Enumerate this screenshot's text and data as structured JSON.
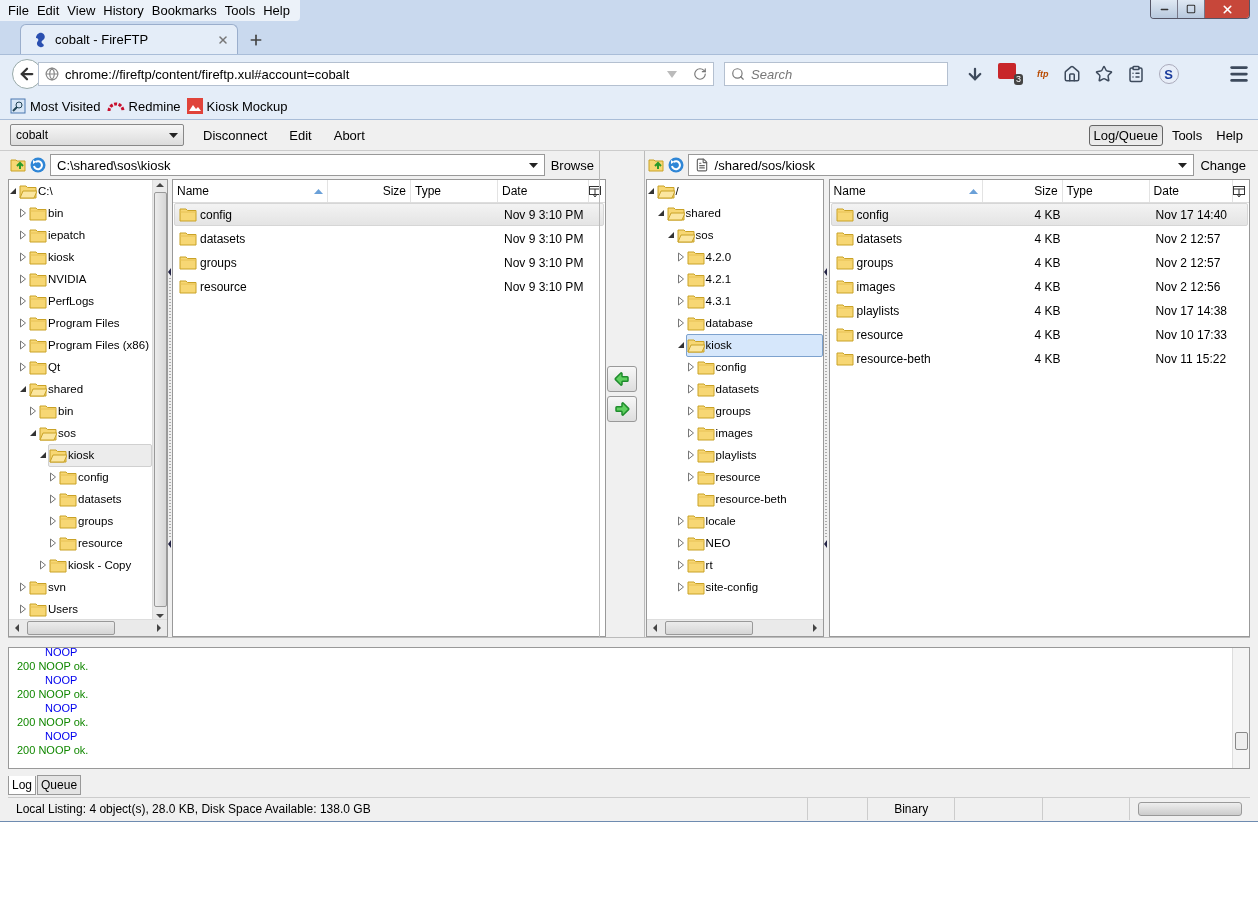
{
  "menu": [
    "File",
    "Edit",
    "View",
    "History",
    "Bookmarks",
    "Tools",
    "Help"
  ],
  "tab": {
    "title": "cobalt - FireFTP",
    "selected": true
  },
  "address": {
    "value": "chrome://fireftp/content/fireftp.xul#account=cobalt"
  },
  "search": {
    "placeholder": "Search"
  },
  "nav_toolbar": {
    "extension_badge": "3",
    "ftp_logo": "ftp",
    "s_logo": "S"
  },
  "bookmarks": [
    {
      "label": "Most Visited",
      "kind": "folder"
    },
    {
      "label": "Redmine",
      "kind": "redmine"
    },
    {
      "label": "Kiosk Mockup",
      "kind": "image"
    }
  ],
  "fireftp_toolbar": {
    "account": "cobalt",
    "left_buttons": [
      "Disconnect",
      "Edit",
      "Abort"
    ],
    "right_buttons": [
      {
        "label": "Log/Queue",
        "pressed": true
      },
      {
        "label": "Tools",
        "pressed": false
      },
      {
        "label": "Help",
        "pressed": false
      }
    ]
  },
  "local": {
    "path": "C:\\shared\\sos\\kiosk",
    "path_button": "Browse",
    "tree": [
      {
        "label": "C:\\",
        "expandable": true,
        "expanded": true,
        "selected": false,
        "children": [
          {
            "label": "bin",
            "expandable": true,
            "expanded": false,
            "selected": false
          },
          {
            "label": "iepatch",
            "expandable": true,
            "expanded": false,
            "selected": false
          },
          {
            "label": "kiosk",
            "expandable": true,
            "expanded": false,
            "selected": false
          },
          {
            "label": "NVIDIA",
            "expandable": true,
            "expanded": false,
            "selected": false
          },
          {
            "label": "PerfLogs",
            "expandable": true,
            "expanded": false,
            "selected": false
          },
          {
            "label": "Program Files",
            "expandable": true,
            "expanded": false,
            "selected": false
          },
          {
            "label": "Program Files (x86)",
            "expandable": true,
            "expanded": false,
            "selected": false
          },
          {
            "label": "Qt",
            "expandable": true,
            "expanded": false,
            "selected": false
          },
          {
            "label": "shared",
            "expandable": true,
            "expanded": true,
            "selected": false,
            "children": [
              {
                "label": "bin",
                "expandable": true,
                "expanded": false,
                "selected": false
              },
              {
                "label": "sos",
                "expandable": true,
                "expanded": true,
                "selected": false,
                "children": [
                  {
                    "label": "kiosk",
                    "expandable": true,
                    "expanded": true,
                    "selected": true,
                    "children": [
                      {
                        "label": "config",
                        "expandable": true,
                        "expanded": false,
                        "selected": false
                      },
                      {
                        "label": "datasets",
                        "expandable": true,
                        "expanded": false,
                        "selected": false
                      },
                      {
                        "label": "groups",
                        "expandable": true,
                        "expanded": false,
                        "selected": false
                      },
                      {
                        "label": "resource",
                        "expandable": true,
                        "expanded": false,
                        "selected": false
                      }
                    ]
                  },
                  {
                    "label": "kiosk - Copy",
                    "expandable": true,
                    "expanded": false,
                    "selected": false
                  }
                ]
              }
            ]
          },
          {
            "label": "svn",
            "expandable": true,
            "expanded": false,
            "selected": false
          },
          {
            "label": "Users",
            "expandable": true,
            "expanded": false,
            "selected": false
          }
        ]
      }
    ],
    "columns": [
      "Name",
      "Size",
      "Type",
      "Date"
    ],
    "rows": [
      {
        "name": "config",
        "size": "",
        "type": "",
        "date": "Nov 9 3:10 PM",
        "selected": true
      },
      {
        "name": "datasets",
        "size": "",
        "type": "",
        "date": "Nov 9 3:10 PM",
        "selected": false
      },
      {
        "name": "groups",
        "size": "",
        "type": "",
        "date": "Nov 9 3:10 PM",
        "selected": false
      },
      {
        "name": "resource",
        "size": "",
        "type": "",
        "date": "Nov 9 3:10 PM",
        "selected": false
      }
    ]
  },
  "remote": {
    "path": "/shared/sos/kiosk",
    "path_button": "Change",
    "tree": [
      {
        "label": "/",
        "expandable": true,
        "expanded": true,
        "selected": false,
        "children": [
          {
            "label": "shared",
            "expandable": true,
            "expanded": true,
            "selected": false,
            "children": [
              {
                "label": "sos",
                "expandable": true,
                "expanded": true,
                "selected": false,
                "children": [
                  {
                    "label": "4.2.0",
                    "expandable": true,
                    "expanded": false,
                    "selected": false
                  },
                  {
                    "label": "4.2.1",
                    "expandable": true,
                    "expanded": false,
                    "selected": false
                  },
                  {
                    "label": "4.3.1",
                    "expandable": true,
                    "expanded": false,
                    "selected": false
                  },
                  {
                    "label": "database",
                    "expandable": true,
                    "expanded": false,
                    "selected": false
                  },
                  {
                    "label": "kiosk",
                    "expandable": true,
                    "expanded": true,
                    "selected": true,
                    "children": [
                      {
                        "label": "config",
                        "expandable": true,
                        "expanded": false,
                        "selected": false
                      },
                      {
                        "label": "datasets",
                        "expandable": true,
                        "expanded": false,
                        "selected": false
                      },
                      {
                        "label": "groups",
                        "expandable": true,
                        "expanded": false,
                        "selected": false
                      },
                      {
                        "label": "images",
                        "expandable": true,
                        "expanded": false,
                        "selected": false
                      },
                      {
                        "label": "playlists",
                        "expandable": true,
                        "expanded": false,
                        "selected": false
                      },
                      {
                        "label": "resource",
                        "expandable": true,
                        "expanded": false,
                        "selected": false
                      },
                      {
                        "label": "resource-beth",
                        "expandable": false,
                        "expanded": false,
                        "selected": false
                      }
                    ]
                  },
                  {
                    "label": "locale",
                    "expandable": true,
                    "expanded": false,
                    "selected": false
                  },
                  {
                    "label": "NEO",
                    "expandable": true,
                    "expanded": false,
                    "selected": false
                  },
                  {
                    "label": "rt",
                    "expandable": true,
                    "expanded": false,
                    "selected": false
                  },
                  {
                    "label": "site-config",
                    "expandable": true,
                    "expanded": false,
                    "selected": false
                  }
                ]
              }
            ]
          }
        ]
      }
    ],
    "columns": [
      "Name",
      "Size",
      "Type",
      "Date"
    ],
    "rows": [
      {
        "name": "config",
        "size": "4 KB",
        "type": "",
        "date": "Nov 17 14:40",
        "selected": true
      },
      {
        "name": "datasets",
        "size": "4 KB",
        "type": "",
        "date": "Nov 2 12:57",
        "selected": false
      },
      {
        "name": "groups",
        "size": "4 KB",
        "type": "",
        "date": "Nov 2 12:57",
        "selected": false
      },
      {
        "name": "images",
        "size": "4 KB",
        "type": "",
        "date": "Nov 2 12:56",
        "selected": false
      },
      {
        "name": "playlists",
        "size": "4 KB",
        "type": "",
        "date": "Nov 17 14:38",
        "selected": false
      },
      {
        "name": "resource",
        "size": "4 KB",
        "type": "",
        "date": "Nov 10 17:33",
        "selected": false
      },
      {
        "name": "resource-beth",
        "size": "4 KB",
        "type": "",
        "date": "Nov 11 15:22",
        "selected": false
      }
    ]
  },
  "log": [
    {
      "text": "NOOP",
      "kind": "command"
    },
    {
      "text": "200 NOOP ok.",
      "kind": "response"
    },
    {
      "text": "NOOP",
      "kind": "command"
    },
    {
      "text": "200 NOOP ok.",
      "kind": "response"
    },
    {
      "text": "NOOP",
      "kind": "command"
    },
    {
      "text": "200 NOOP ok.",
      "kind": "response"
    },
    {
      "text": "NOOP",
      "kind": "command"
    },
    {
      "text": "200 NOOP ok.",
      "kind": "response"
    }
  ],
  "bottom_tabs": [
    {
      "label": "Log",
      "selected": true
    },
    {
      "label": "Queue",
      "selected": false
    }
  ],
  "status_bar": {
    "listing": "Local Listing: 4 object(s), 28.0 KB, Disk Space Available: 138.0 GB",
    "mode": "Binary",
    "progress": {
      "level": 0
    }
  }
}
